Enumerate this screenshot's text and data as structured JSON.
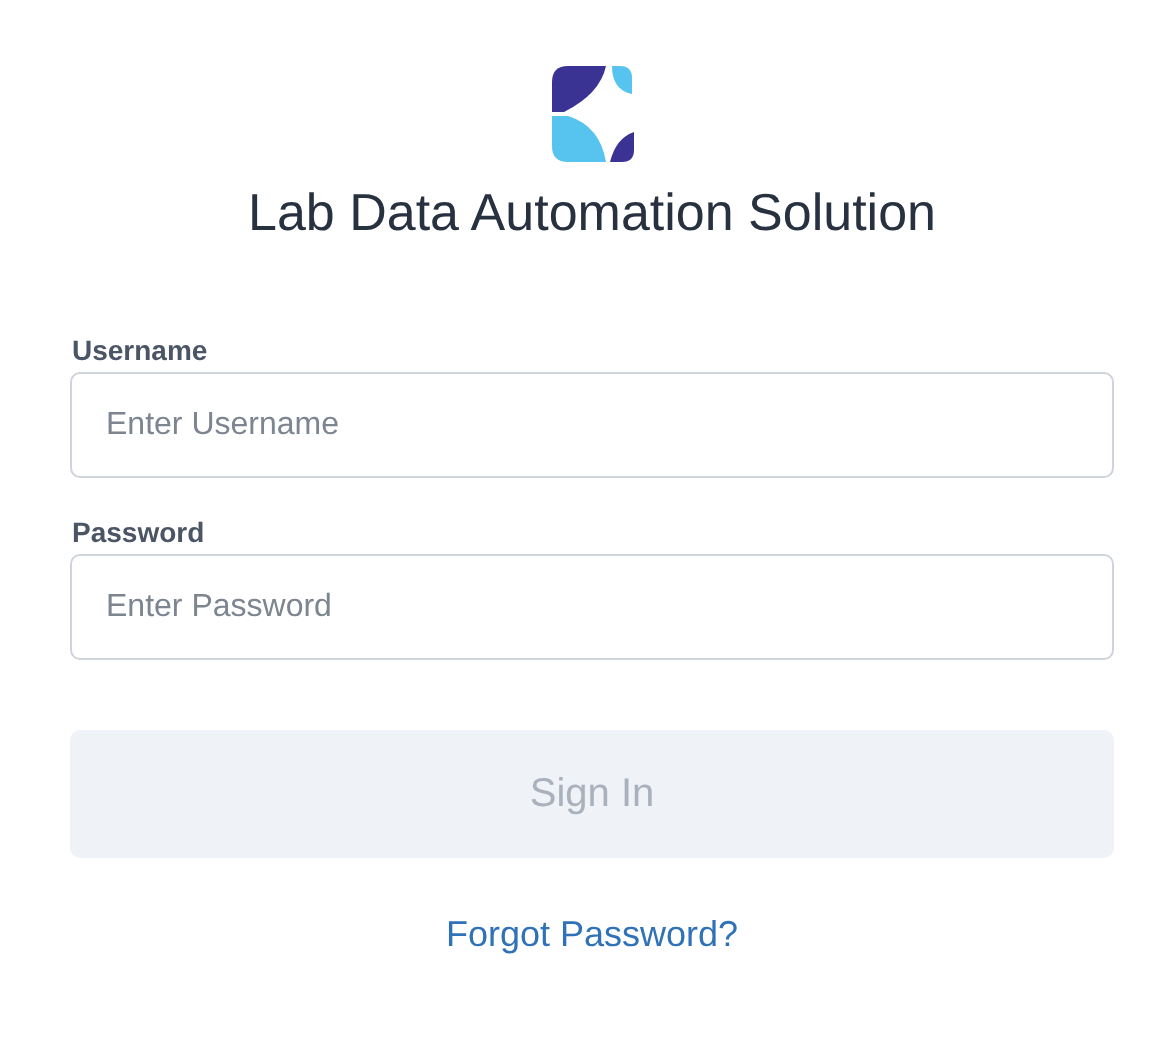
{
  "title": "Lab Data Automation Solution",
  "fields": [
    {
      "label": "Username",
      "placeholder": "Enter Username"
    },
    {
      "label": "Password",
      "placeholder": "Enter Password"
    }
  ],
  "sign_in": {
    "label": "Sign In",
    "disabled": true
  },
  "forgot_link": "Forgot Password?"
}
